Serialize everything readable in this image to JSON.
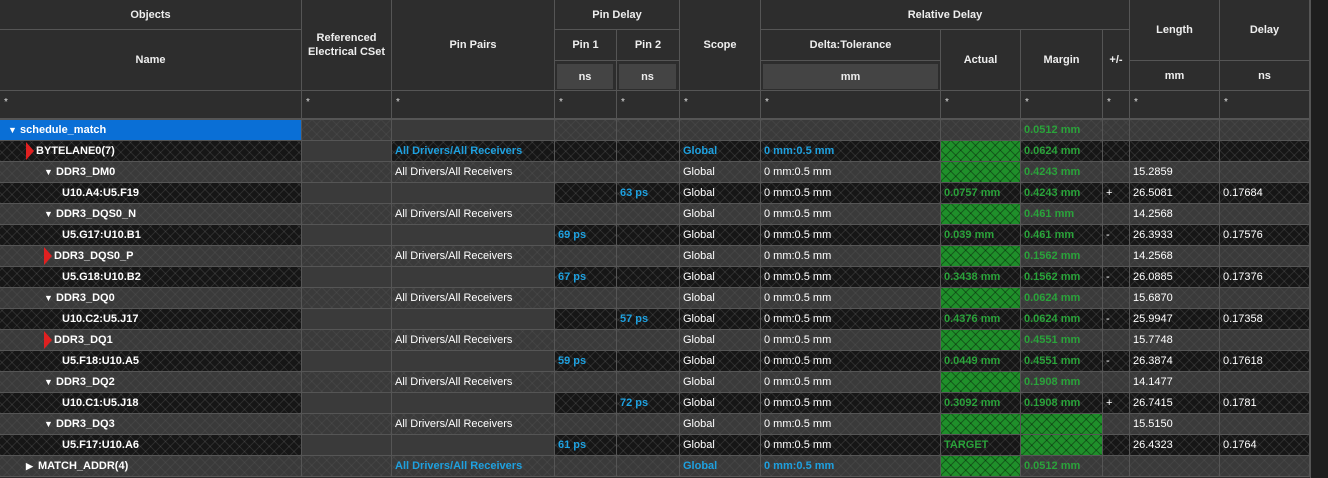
{
  "headers": {
    "objects": "Objects",
    "name": "Name",
    "ref_cset": "Referenced Electrical CSet",
    "pin_pairs": "Pin Pairs",
    "pin_delay": "Pin Delay",
    "pin1": "Pin 1",
    "pin2": "Pin 2",
    "pin_unit": "ns",
    "scope": "Scope",
    "relative_delay": "Relative Delay",
    "delta_tol": "Delta:Tolerance",
    "delta_unit": "mm",
    "actual": "Actual",
    "margin": "Margin",
    "plusminus": "+/-",
    "length": "Length",
    "length_unit": "mm",
    "delay": "Delay",
    "delay_unit": "ns",
    "filter": "*"
  },
  "colors": {
    "selected": "#0a6fd6",
    "link": "#1ea1e0",
    "pass": "#2aa33a",
    "fill": "#1f8f2a"
  },
  "rows": [
    {
      "type": "sel",
      "level": 0,
      "exp": "down",
      "name": "schedule_match",
      "pairs": "",
      "pin1": "",
      "pin2": "",
      "scope": "",
      "delta": "",
      "actual": "",
      "actualFill": false,
      "margin": "0.0512 mm",
      "marginFill": false,
      "sign": "",
      "length": "",
      "delay": "",
      "blue": false
    },
    {
      "type": "p",
      "level": 1,
      "exp": "red",
      "name": "BYTELANE0(7)",
      "pairs": "All Drivers/All Receivers",
      "pin1": "",
      "pin2": "",
      "scope": "Global",
      "delta": "0 mm:0.5 mm",
      "actual": "",
      "actualFill": true,
      "margin": "0.0624 mm",
      "marginFill": false,
      "sign": "",
      "length": "",
      "delay": "",
      "blue": true
    },
    {
      "type": "g",
      "level": 2,
      "exp": "down",
      "name": "DDR3_DM0",
      "pairs": "All Drivers/All Receivers",
      "pin1": "",
      "pin2": "",
      "scope": "Global",
      "delta": "0 mm:0.5 mm",
      "actual": "",
      "actualFill": true,
      "margin": "0.4243 mm",
      "marginFill": false,
      "sign": "",
      "length": "15.2859",
      "delay": ""
    },
    {
      "type": "p",
      "level": 3,
      "exp": "",
      "name": "U10.A4:U5.F19",
      "pairs": "",
      "pin1": "",
      "pin2": "63 ps",
      "scope": "Global",
      "delta": "0 mm:0.5 mm",
      "actual": "0.0757 mm",
      "actualFill": false,
      "margin": "0.4243 mm",
      "marginFill": false,
      "sign": "+",
      "length": "26.5081",
      "delay": "0.17684"
    },
    {
      "type": "g",
      "level": 2,
      "exp": "down",
      "name": "DDR3_DQS0_N",
      "pairs": "All Drivers/All Receivers",
      "pin1": "",
      "pin2": "",
      "scope": "Global",
      "delta": "0 mm:0.5 mm",
      "actual": "",
      "actualFill": true,
      "margin": "0.461 mm",
      "marginFill": false,
      "sign": "",
      "length": "14.2568",
      "delay": ""
    },
    {
      "type": "p",
      "level": 3,
      "exp": "",
      "name": "U5.G17:U10.B1",
      "pairs": "",
      "pin1": "69 ps",
      "pin2": "",
      "scope": "Global",
      "delta": "0 mm:0.5 mm",
      "actual": "0.039 mm",
      "actualFill": false,
      "margin": "0.461 mm",
      "marginFill": false,
      "sign": "-",
      "length": "26.3933",
      "delay": "0.17576"
    },
    {
      "type": "g",
      "level": 2,
      "exp": "red",
      "name": "DDR3_DQS0_P",
      "pairs": "All Drivers/All Receivers",
      "pin1": "",
      "pin2": "",
      "scope": "Global",
      "delta": "0 mm:0.5 mm",
      "actual": "",
      "actualFill": true,
      "margin": "0.1562 mm",
      "marginFill": false,
      "sign": "",
      "length": "14.2568",
      "delay": ""
    },
    {
      "type": "p",
      "level": 3,
      "exp": "",
      "name": "U5.G18:U10.B2",
      "pairs": "",
      "pin1": "67 ps",
      "pin2": "",
      "scope": "Global",
      "delta": "0 mm:0.5 mm",
      "actual": "0.3438 mm",
      "actualFill": false,
      "margin": "0.1562 mm",
      "marginFill": false,
      "sign": "-",
      "length": "26.0885",
      "delay": "0.17376"
    },
    {
      "type": "g",
      "level": 2,
      "exp": "down",
      "name": "DDR3_DQ0",
      "pairs": "All Drivers/All Receivers",
      "pin1": "",
      "pin2": "",
      "scope": "Global",
      "delta": "0 mm:0.5 mm",
      "actual": "",
      "actualFill": true,
      "margin": "0.0624 mm",
      "marginFill": false,
      "sign": "",
      "length": "15.6870",
      "delay": ""
    },
    {
      "type": "p",
      "level": 3,
      "exp": "",
      "name": "U10.C2:U5.J17",
      "pairs": "",
      "pin1": "",
      "pin2": "57 ps",
      "scope": "Global",
      "delta": "0 mm:0.5 mm",
      "actual": "0.4376 mm",
      "actualFill": false,
      "margin": "0.0624 mm",
      "marginFill": false,
      "sign": "-",
      "length": "25.9947",
      "delay": "0.17358"
    },
    {
      "type": "g",
      "level": 2,
      "exp": "red",
      "name": "DDR3_DQ1",
      "pairs": "All Drivers/All Receivers",
      "pin1": "",
      "pin2": "",
      "scope": "Global",
      "delta": "0 mm:0.5 mm",
      "actual": "",
      "actualFill": true,
      "margin": "0.4551 mm",
      "marginFill": false,
      "sign": "",
      "length": "15.7748",
      "delay": ""
    },
    {
      "type": "p",
      "level": 3,
      "exp": "",
      "name": "U5.F18:U10.A5",
      "pairs": "",
      "pin1": "59 ps",
      "pin2": "",
      "scope": "Global",
      "delta": "0 mm:0.5 mm",
      "actual": "0.0449 mm",
      "actualFill": false,
      "margin": "0.4551 mm",
      "marginFill": false,
      "sign": "-",
      "length": "26.3874",
      "delay": "0.17618"
    },
    {
      "type": "g",
      "level": 2,
      "exp": "down",
      "name": "DDR3_DQ2",
      "pairs": "All Drivers/All Receivers",
      "pin1": "",
      "pin2": "",
      "scope": "Global",
      "delta": "0 mm:0.5 mm",
      "actual": "",
      "actualFill": true,
      "margin": "0.1908 mm",
      "marginFill": false,
      "sign": "",
      "length": "14.1477",
      "delay": ""
    },
    {
      "type": "p",
      "level": 3,
      "exp": "",
      "name": "U10.C1:U5.J18",
      "pairs": "",
      "pin1": "",
      "pin2": "72 ps",
      "scope": "Global",
      "delta": "0 mm:0.5 mm",
      "actual": "0.3092 mm",
      "actualFill": false,
      "margin": "0.1908 mm",
      "marginFill": false,
      "sign": "+",
      "length": "26.7415",
      "delay": "0.1781"
    },
    {
      "type": "g",
      "level": 2,
      "exp": "down",
      "name": "DDR3_DQ3",
      "pairs": "All Drivers/All Receivers",
      "pin1": "",
      "pin2": "",
      "scope": "Global",
      "delta": "0 mm:0.5 mm",
      "actual": "",
      "actualFill": true,
      "margin": "",
      "marginFill": true,
      "sign": "",
      "length": "15.5150",
      "delay": ""
    },
    {
      "type": "p",
      "level": 3,
      "exp": "",
      "name": "U5.F17:U10.A6",
      "pairs": "",
      "pin1": "61 ps",
      "pin2": "",
      "scope": "Global",
      "delta": "0 mm:0.5 mm",
      "actual": "TARGET",
      "actualFill": false,
      "margin": "",
      "marginFill": true,
      "sign": "",
      "length": "26.4323",
      "delay": "0.1764"
    },
    {
      "type": "g",
      "level": 1,
      "exp": "right",
      "name": "MATCH_ADDR(4)",
      "pairs": "All Drivers/All Receivers",
      "pin1": "",
      "pin2": "",
      "scope": "Global",
      "delta": "0 mm:0.5 mm",
      "actual": "",
      "actualFill": true,
      "margin": "0.0512 mm",
      "marginFill": false,
      "sign": "",
      "length": "",
      "delay": "",
      "blue": true
    }
  ]
}
